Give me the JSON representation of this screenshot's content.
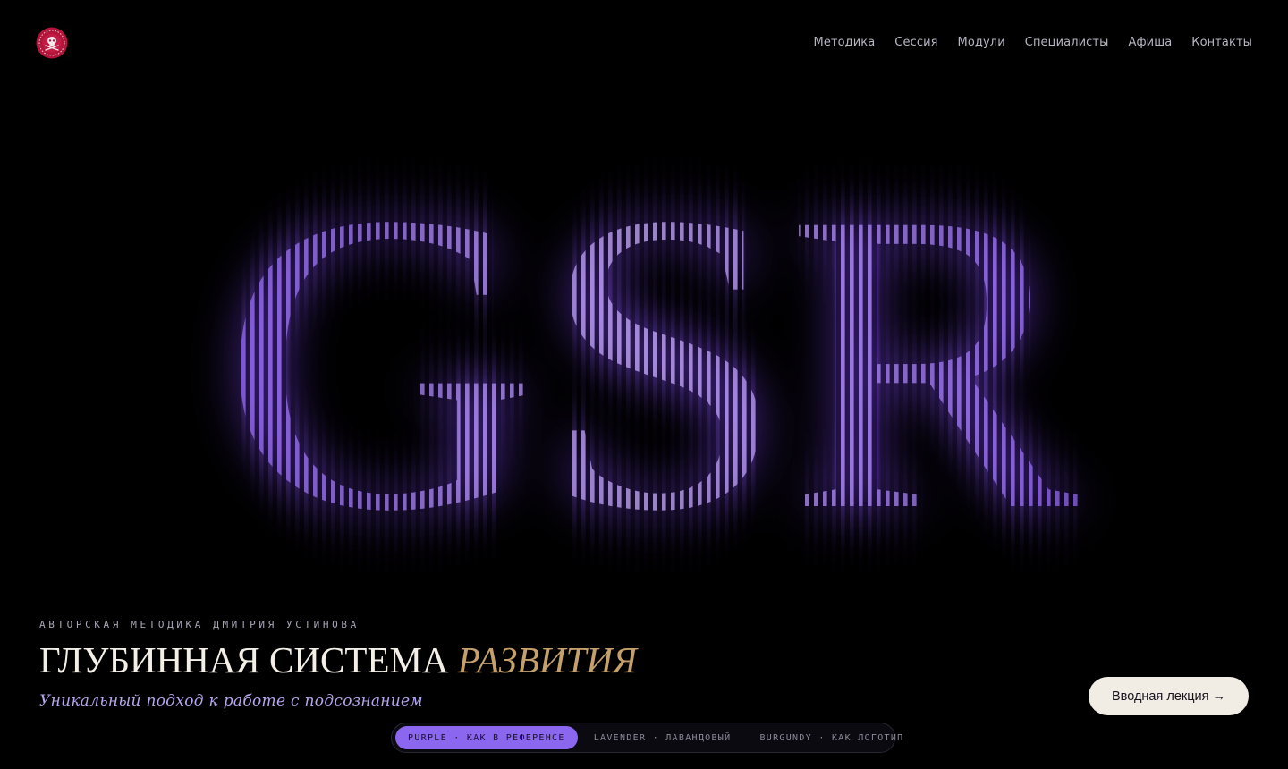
{
  "brand": {
    "logo_icon": "skull-emblem-icon",
    "logo_color": "#b1163a"
  },
  "nav": {
    "items": [
      {
        "label": "Методика"
      },
      {
        "label": "Сессия"
      },
      {
        "label": "Модули"
      },
      {
        "label": "Специалисты"
      },
      {
        "label": "Афиша"
      },
      {
        "label": "Контакты"
      }
    ]
  },
  "hero": {
    "letters": "GSR",
    "glow_color": "#9b6cff",
    "stripe_color": "#a77bff"
  },
  "intro": {
    "eyebrow": "АВТОРСКАЯ МЕТОДИКА ДМИТРИЯ УСТИНОВА",
    "headline_main": "ГЛУБИННАЯ СИСТЕМА ",
    "headline_accent": "РАЗВИТИЯ",
    "subtitle": "Уникальный подход к работе с подсознанием"
  },
  "cta": {
    "label": "Вводная лекция →"
  },
  "palette": {
    "options": [
      {
        "label": "PURPLE · КАК В РЕФЕРЕНСЕ",
        "active": true
      },
      {
        "label": "LAVENDER · ЛАВАНДОВЫЙ",
        "active": false
      },
      {
        "label": "BURGUNDY · КАК ЛОГОТИП",
        "active": false
      }
    ],
    "active_color": "#8b66ee"
  }
}
